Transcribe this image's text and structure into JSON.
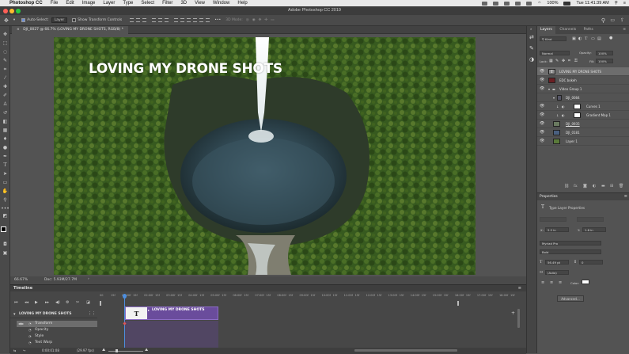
{
  "menubar": {
    "app_name": "Photoshop CC",
    "items": [
      "File",
      "Edit",
      "Image",
      "Layer",
      "Type",
      "Select",
      "Filter",
      "3D",
      "View",
      "Window",
      "Help"
    ],
    "battery": "100%",
    "clock": "Tue 11:41:39 AM"
  },
  "window": {
    "title": "Adobe Photoshop CC 2019"
  },
  "options_bar": {
    "auto_select_label": "Auto-Select:",
    "auto_select_target": "Layer",
    "show_transform_label": "Show Transform Controls",
    "mode_3d_label": "3D Mode:"
  },
  "document": {
    "tab_label": "DJI_0027 @ 66.7% (LOVING MY DRONE SHOTS, RGB/8) *",
    "headline": "LOVING MY DRONE SHOTS",
    "zoom": "66.67%",
    "doc_info": "Doc: 5.93M/27.7M"
  },
  "timeline": {
    "title": "Timeline",
    "ruler_ticks": [
      "00",
      "15f",
      "01:00f",
      "15f",
      "02:00f",
      "15f",
      "03:00f",
      "15f",
      "04:00f",
      "15f",
      "05:00f",
      "15f",
      "06:00f",
      "15f",
      "07:00f",
      "15f",
      "08:00f",
      "15f",
      "09:00f",
      "15f",
      "10:00f",
      "15f",
      "11:00f",
      "15f",
      "12:00f",
      "15f",
      "13:00f",
      "15f",
      "14:00f",
      "15f",
      "15:00f",
      "15f",
      "16:00f",
      "15f",
      "17:00f",
      "15f",
      "18:00f",
      "15f"
    ],
    "track_name": "LOVING MY DRONE SHOTS",
    "clip_label": "LOVING MY DRONE SHOTS",
    "clip_thumb": "T",
    "properties": [
      "Transform",
      "Opacity",
      "Style",
      "Text Warp"
    ],
    "current_time": "0:00:01:08",
    "fps": "(29.97 fps)"
  },
  "layers_panel": {
    "tabs": [
      "Layers",
      "Channels",
      "Paths"
    ],
    "filter_kind": "Kind",
    "blend_mode": "Normal",
    "opacity_label": "Opacity:",
    "opacity_value": "100%",
    "lock_label": "Lock:",
    "fill_label": "Fill:",
    "fill_value": "100%",
    "layers": [
      {
        "name": "LOVING MY DRONE SHOTS",
        "kind": "type",
        "indent": 0,
        "selected": true
      },
      {
        "name": "EDC bokeh",
        "kind": "image",
        "indent": 0,
        "selected": false
      },
      {
        "name": "Video Group 1",
        "kind": "group",
        "indent": 0,
        "selected": false
      },
      {
        "name": "DJI_0084",
        "kind": "video",
        "indent": 1,
        "selected": false
      },
      {
        "name": "Curves 1",
        "kind": "adjustment",
        "indent": 2,
        "selected": false
      },
      {
        "name": "Gradient Map 1",
        "kind": "adjustment",
        "indent": 2,
        "selected": false
      },
      {
        "name": "DJI_0935",
        "kind": "video",
        "indent": 1,
        "selected": false
      },
      {
        "name": "DJI_0181",
        "kind": "video",
        "indent": 1,
        "selected": false
      },
      {
        "name": "Layer 1",
        "kind": "video",
        "indent": 1,
        "selected": false
      }
    ]
  },
  "properties_panel": {
    "title": "Properties",
    "subtitle": "Type Layer Properties",
    "x_label": "X:",
    "x_value": "2.2 in",
    "y_label": "Y:",
    "y_value": "1.6 in",
    "font_family": "Myriad Pro",
    "font_style": "Bold",
    "font_size": "56.49 pt",
    "leading": "0",
    "tracking": "(Auto)",
    "color_label": "Color:",
    "advanced_button": "Advanced..."
  },
  "colors": {
    "accent": "#6a4c9c",
    "panel": "#535353",
    "selection": "#6d6d6d"
  }
}
